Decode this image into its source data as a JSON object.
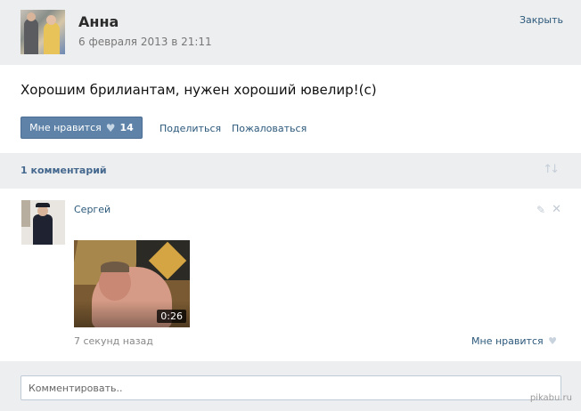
{
  "post": {
    "author": "Анна",
    "date": "6 февраля 2013 в 21:11",
    "close_label": "Закрыть",
    "text": "Хорошим брилиантам, нужен хороший ювелир!(с)",
    "like_label": "Мне нравится",
    "like_count": "14",
    "share_label": "Поделиться",
    "report_label": "Пожаловаться"
  },
  "comments": {
    "count_label": "1 комментарий",
    "items": [
      {
        "author": "Сергей",
        "video_duration": "0:26",
        "time": "7 секунд назад",
        "like_label": "Мне нравится"
      }
    ],
    "input_placeholder": "Комментировать.."
  },
  "watermark": "pikabu.ru",
  "icons": {
    "heart": "heart-icon",
    "sort": "sort-icon",
    "edit": "pencil-icon",
    "delete": "close-icon"
  },
  "colors": {
    "link": "#2b587a",
    "like_button": "#5e82a8",
    "panel_bg": "#edeef0"
  }
}
